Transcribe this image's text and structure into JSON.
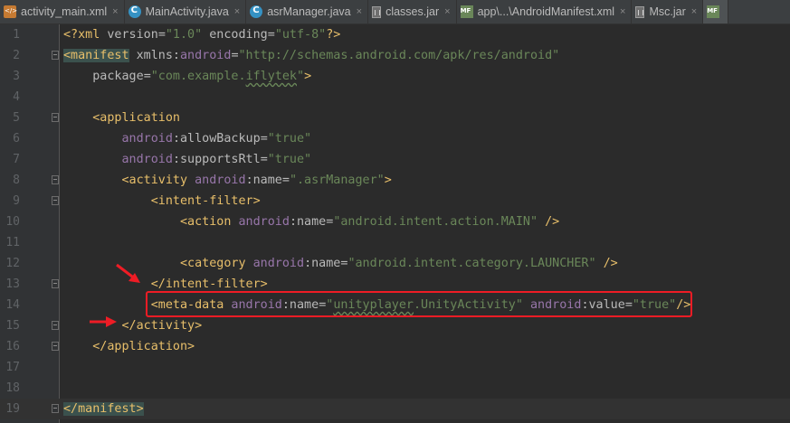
{
  "tabs": [
    {
      "label": "activity_main.xml",
      "icon": "xml-file-icon"
    },
    {
      "label": "MainActivity.java",
      "icon": "java-class-icon"
    },
    {
      "label": "asrManager.java",
      "icon": "java-class-icon"
    },
    {
      "label": "classes.jar",
      "icon": "jar-file-icon"
    },
    {
      "label": "app\\...\\AndroidManifest.xml",
      "icon": "manifest-file-icon"
    },
    {
      "label": "Msc.jar",
      "icon": "jar-file-icon"
    }
  ],
  "close_glyph": "×",
  "line_numbers": [
    "1",
    "2",
    "3",
    "4",
    "5",
    "6",
    "7",
    "8",
    "9",
    "10",
    "11",
    "12",
    "13",
    "14",
    "15",
    "16",
    "17",
    "18",
    "19"
  ],
  "code": {
    "l1": {
      "a": "<?xml ",
      "b": "version",
      "c": "=",
      "d": "\"1.0\"",
      "e": " encoding",
      "f": "=",
      "g": "\"utf-8\"",
      "h": "?>"
    },
    "l2": {
      "tag": "<manifest",
      "a": " xmlns:",
      "ns": "android",
      "eq": "=",
      "val": "\"http://schemas.android.com/apk/res/android\""
    },
    "l3": {
      "attr": "package",
      "eq": "=",
      "q1": "\"com.example.",
      "sq": "iflytek",
      "q2": "\"",
      "close": ">"
    },
    "l5": {
      "tag": "<application"
    },
    "l6": {
      "ns": "android",
      "attr": ":allowBackup",
      "eq": "=",
      "val": "\"true\""
    },
    "l7": {
      "ns": "android",
      "attr": ":supportsRtl",
      "eq": "=",
      "val": "\"true\""
    },
    "l8": {
      "tag": "<activity",
      "ns": " android",
      "attr": ":name",
      "eq": "=",
      "val": "\".asrManager\"",
      "close": ">"
    },
    "l9": {
      "tag": "<intent-filter>"
    },
    "l10": {
      "tag": "<action",
      "ns": " android",
      "attr": ":name",
      "eq": "=",
      "val": "\"android.intent.action.MAIN\"",
      "close": " />"
    },
    "l12": {
      "tag": "<category",
      "ns": " android",
      "attr": ":name",
      "eq": "=",
      "val": "\"android.intent.category.LAUNCHER\"",
      "close": " />"
    },
    "l13": {
      "tag": "</intent-filter>"
    },
    "l14": {
      "tag": "<meta-data",
      "ns1": " android",
      "attr1": ":name",
      "eq1": "=",
      "q1": "\"",
      "sq": "unityplayer",
      "v1": ".UnityActivity\"",
      "ns2": " android",
      "attr2": ":value",
      "eq2": "=",
      "v2": "\"true\"",
      "close": "/>"
    },
    "l15": {
      "tag": "</activity>"
    },
    "l16": {
      "tag": "</application>"
    },
    "l19": {
      "tag": "</manifest>"
    }
  },
  "colors": {
    "background": "#2b2b2b",
    "tag": "#e8bf6a",
    "namespace": "#9876aa",
    "attribute": "#bababa",
    "value": "#6a8759",
    "annotation": "#ee1c25"
  }
}
